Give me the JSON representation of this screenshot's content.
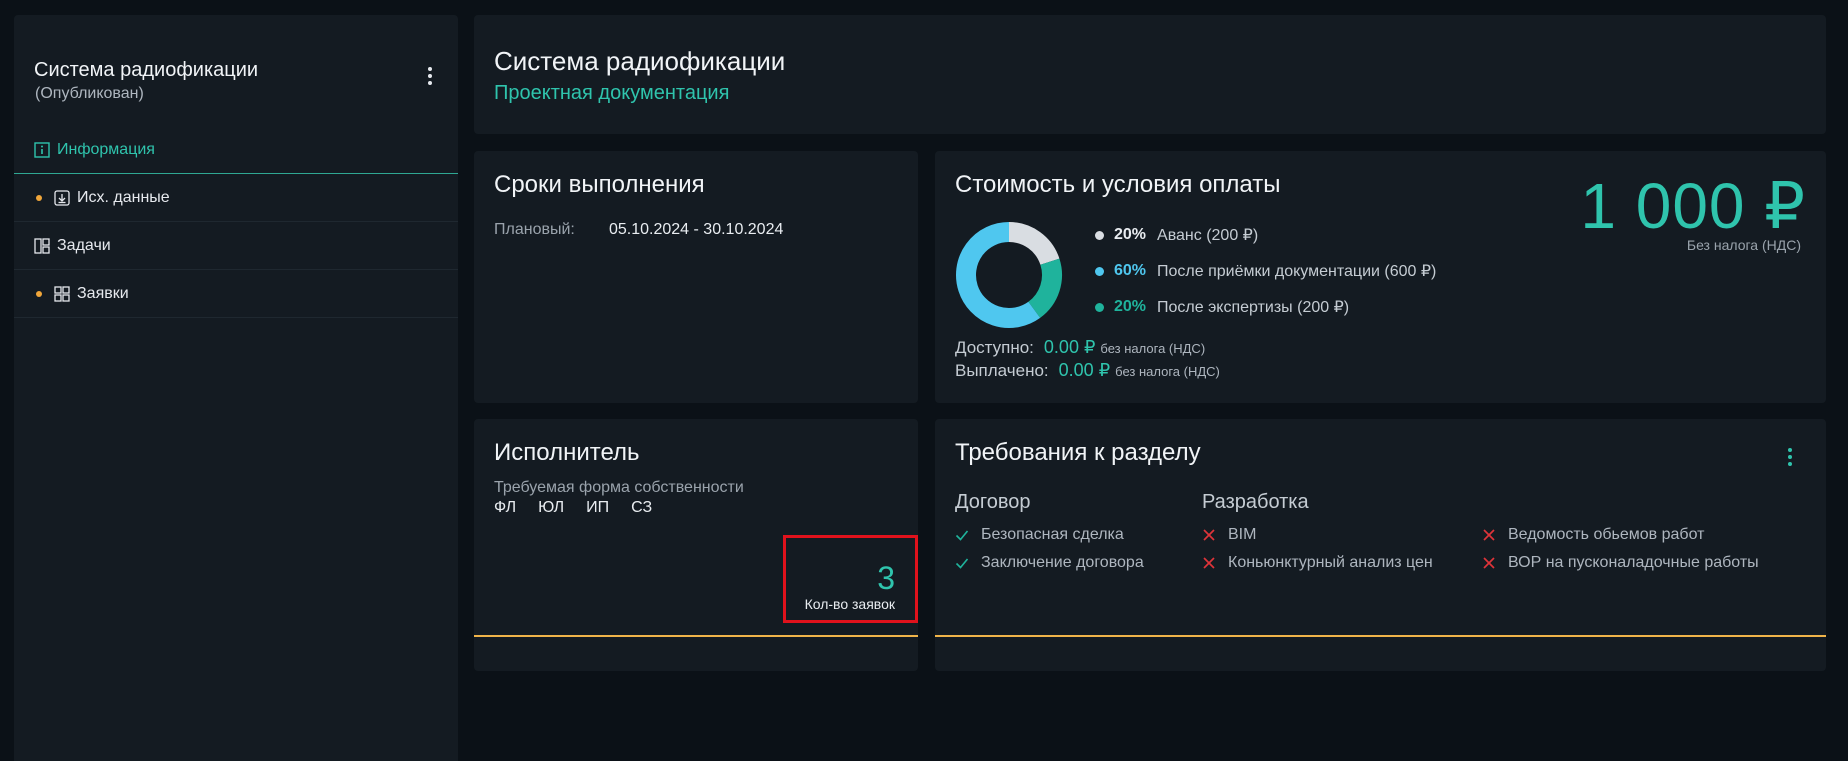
{
  "sidebar": {
    "title": "Система радиофикации",
    "status": "(Опубликован)",
    "items": [
      {
        "label": "Информация",
        "icon": "info-icon"
      },
      {
        "label": "Исх. данные",
        "icon": "download-icon"
      },
      {
        "label": "Задачи",
        "icon": "tasks-icon"
      },
      {
        "label": "Заявки",
        "icon": "applications-icon"
      }
    ]
  },
  "header": {
    "title": "Система радиофикации",
    "subtitle": "Проектная документация"
  },
  "schedule": {
    "title": "Сроки выполнения",
    "plan_label": "Плановый:",
    "plan_value": "05.10.2024 - 30.10.2024"
  },
  "cost": {
    "title": "Стоимость и условия оплаты",
    "price": "1 000 ₽",
    "price_note": "Без налога (НДС)",
    "payments": [
      {
        "pct": "20%",
        "text": "Аванс (200 ₽)",
        "color": "#d9dde2"
      },
      {
        "pct": "60%",
        "text": "После приёмки документации (600 ₽)",
        "color": "#4fc7ef"
      },
      {
        "pct": "20%",
        "text": "После экспертизы (200 ₽)",
        "color": "#1fb39c"
      }
    ],
    "available_label": "Доступно:",
    "available_amount": "0.00 ₽",
    "paid_label": "Выплачено:",
    "paid_amount": "0.00 ₽",
    "nds_note": "без налога (НДС)"
  },
  "executor": {
    "title": "Исполнитель",
    "ownership_label": "Требуемая форма собственности",
    "ownership_forms": [
      "ФЛ",
      "ЮЛ",
      "ИП",
      "СЗ"
    ],
    "applications_count": "3",
    "applications_label": "Кол-во заявок"
  },
  "requirements": {
    "title": "Требования к разделу",
    "contract_header": "Договор",
    "contract_items": [
      "Безопасная сделка",
      "Заключение договора"
    ],
    "dev_header": "Разработка",
    "dev_items": [
      "BIM",
      "Коньюнктурный анализ цен"
    ],
    "other_items": [
      "Ведомость обьемов работ",
      "ВОР на пусконаладочные работы"
    ]
  },
  "colors": {
    "accent": "#2fc4ad",
    "warning_dot": "#f0a63a",
    "highlight_border": "#e0121c",
    "cross": "#e0343a"
  }
}
